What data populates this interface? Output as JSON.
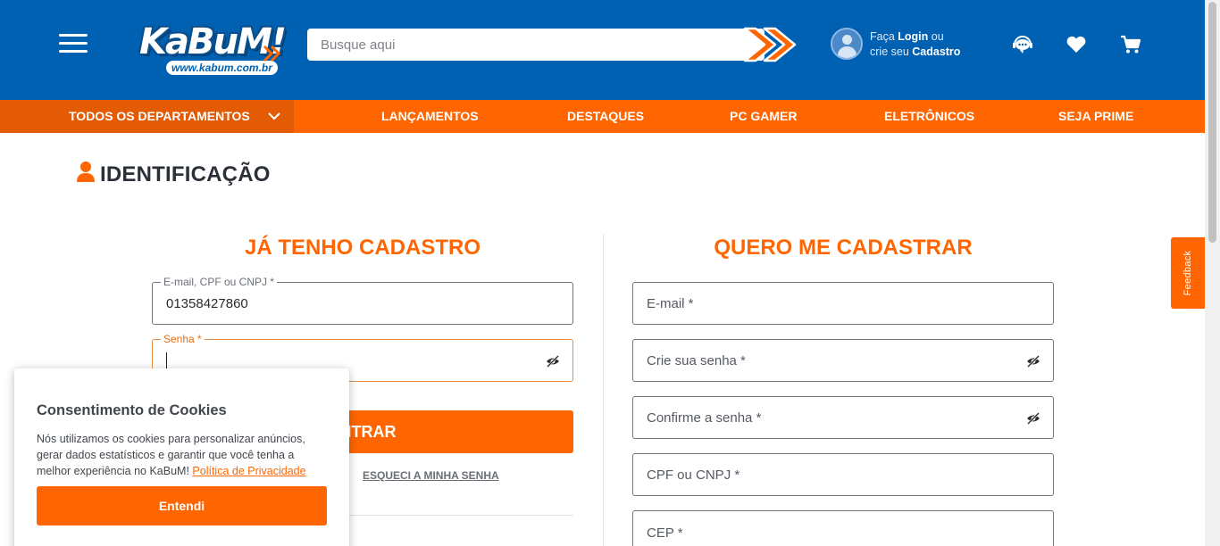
{
  "header": {
    "logo_text": "KaBuM!",
    "logo_subtext": "www.kabum.com.br",
    "search_placeholder": "Busque aqui",
    "login_prefix": "Faça ",
    "login_bold": "Login",
    "login_suffix": " ou",
    "register_prefix": "crie seu ",
    "register_bold": "Cadastro",
    "icons": [
      "menu-icon",
      "search-submit-arrow-icon",
      "avatar-icon",
      "support-chat-icon",
      "heart-icon",
      "cart-icon"
    ]
  },
  "nav": {
    "departments": "TODOS OS DEPARTAMENTOS",
    "items": [
      "LANÇAMENTOS",
      "DESTAQUES",
      "PC GAMER",
      "ELETRÔNICOS",
      "SEJA PRIME"
    ]
  },
  "page": {
    "title": "IDENTIFICAÇÃO"
  },
  "login": {
    "heading": "JÁ TENHO CADASTRO",
    "identifier_label": "E-mail, CPF ou CNPJ *",
    "identifier_value": "01358427860",
    "password_label": "Senha *",
    "password_value": "",
    "submit_label": "ENTRAR",
    "forgot_label": "ESQUECI A MINHA SENHA"
  },
  "register": {
    "heading": "QUERO ME CADASTRAR",
    "email_placeholder": "E-mail *",
    "password_placeholder": "Crie sua senha *",
    "confirm_placeholder": "Confirme a senha *",
    "document_placeholder": "CPF ou CNPJ *",
    "cep_placeholder": "CEP *"
  },
  "feedback_tab": "Feedback",
  "cookie": {
    "title": "Consentimento de Cookies",
    "body": "Nós utilizamos os cookies para personalizar anúncios, gerar dados estatísticos e garantir que você tenha a melhor experiência no KaBuM! ",
    "link": "Política de Privacidade",
    "button": "Entendi"
  },
  "colors": {
    "header_blue": "#0060b1",
    "accent_orange": "#ff6500",
    "text_dark": "#2b2f38"
  }
}
